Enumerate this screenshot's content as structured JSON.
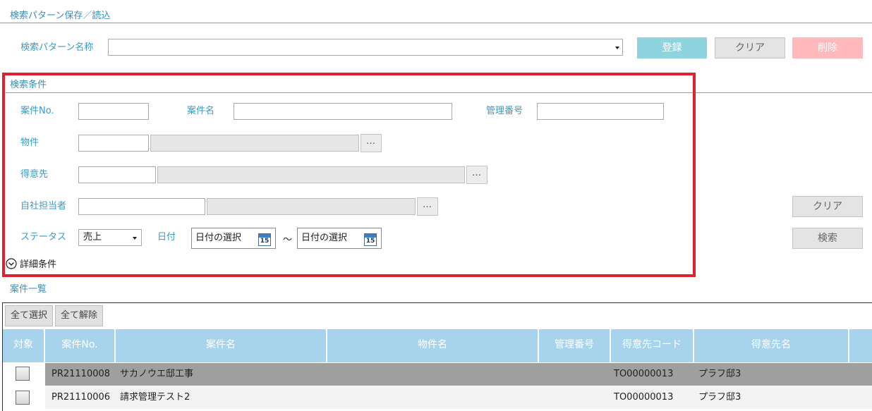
{
  "pattern_section": {
    "title": "検索パターン保存／読込",
    "name_label": "検索パターン名称",
    "name_value": "",
    "register_label": "登録",
    "clear_label": "クリア",
    "delete_label": "削除"
  },
  "search": {
    "title": "検索条件",
    "case_no_label": "案件No.",
    "case_name_label": "案件名",
    "mgmt_no_label": "管理番号",
    "property_label": "物件",
    "customer_label": "得意先",
    "staff_label": "自社担当者",
    "status_label": "ステータス",
    "status_value": "売上",
    "date_label": "日付",
    "date_from_placeholder": "日付の選択",
    "date_to_placeholder": "日付の選択",
    "date_sep": "～",
    "calendar_day": "15",
    "dots": "…",
    "detail_label": "詳細条件",
    "clear_label": "クリア",
    "search_label": "検索"
  },
  "list": {
    "title": "案件一覧",
    "select_all_label": "全て選択",
    "deselect_all_label": "全て解除",
    "headers": {
      "target": "対象",
      "case_no": "案件No.",
      "case_name": "案件名",
      "property_name": "物件名",
      "mgmt_no": "管理番号",
      "customer_code": "得意先コード",
      "customer_name": "得意先名"
    },
    "rows": [
      {
        "case_no": "PR21110008",
        "case_name": "サカノウエ邸工事",
        "customer_code": "TO00000013",
        "customer_name": "プラフ邸3"
      },
      {
        "case_no": "PR21110006",
        "case_name": "請求管理テスト2",
        "customer_code": "TO00000013",
        "customer_name": "プラフ邸3"
      }
    ]
  },
  "colors": {
    "accent_text": "#3a9bc4",
    "highlight_border": "#e0202d",
    "header_bg": "#a8d3ec",
    "register_bg": "#8fd3df",
    "delete_bg": "#ffb8bc",
    "selected_row_bg": "#9f9f9f"
  }
}
